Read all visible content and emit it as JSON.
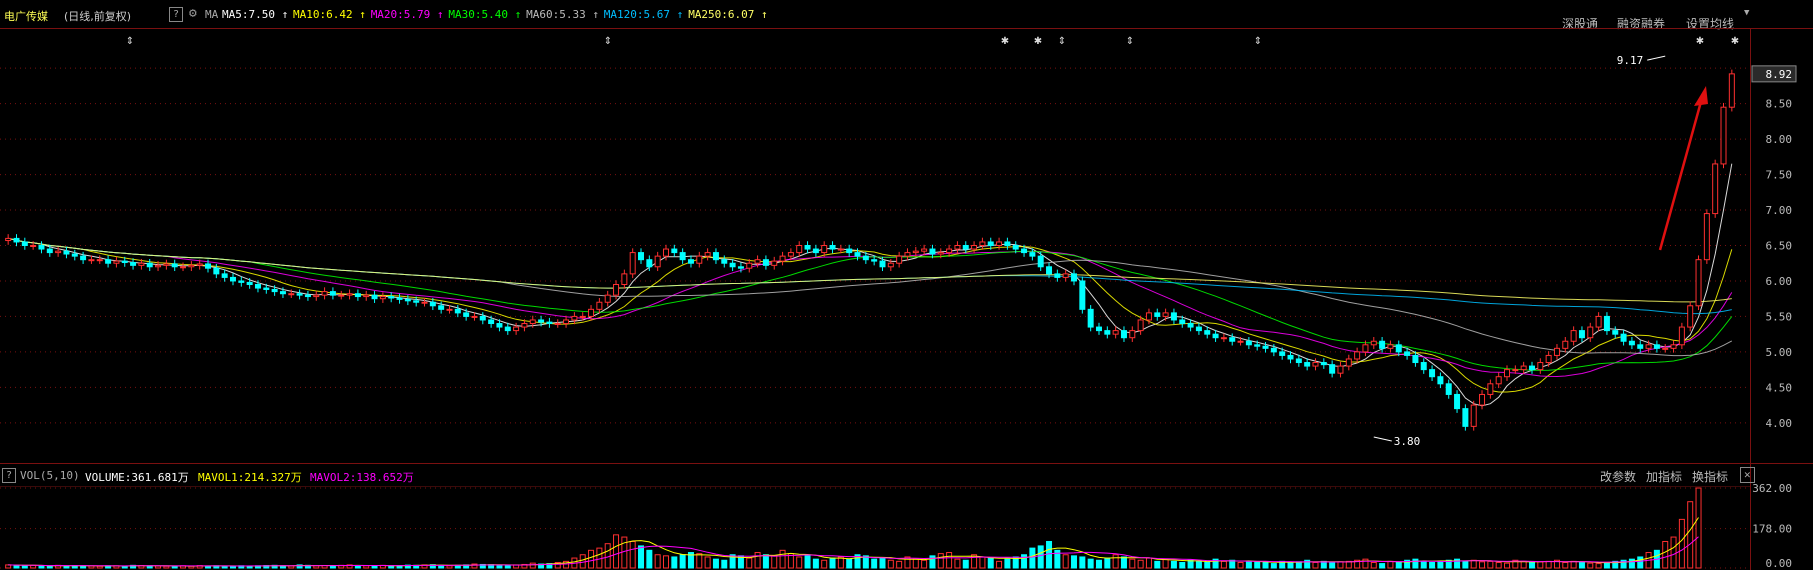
{
  "header": {
    "title": "电广传媒",
    "subtitle": "(日线,前复权)",
    "help": "?",
    "ma_prefix": "MA",
    "ma": [
      {
        "label": "MA5:7.50",
        "color": "#ffffff"
      },
      {
        "label": "MA10:6.42",
        "color": "#ffff00"
      },
      {
        "label": "MA20:5.79",
        "color": "#ff00ff"
      },
      {
        "label": "MA30:5.40",
        "color": "#00ff00"
      },
      {
        "label": "MA60:5.33",
        "color": "#bbbbbb"
      },
      {
        "label": "MA120:5.67",
        "color": "#00bfff"
      },
      {
        "label": "MA250:6.07",
        "color": "#ffff66"
      }
    ],
    "links": [
      "深股通",
      "融资融券",
      "设置均线"
    ]
  },
  "volume_header": {
    "help": "?",
    "label": "VOL(5,10)",
    "volume": "VOLUME:361.681万",
    "mavol1": "MAVOL1:214.327万",
    "mavol2": "MAVOL2:138.652万",
    "buttons": [
      "改参数",
      "加指标",
      "换指标"
    ],
    "close": "✕"
  },
  "colors": {
    "up": "#ff3030",
    "down": "#00ffff",
    "bg": "#000000",
    "grid": "#7a1010"
  },
  "chart_data": [
    {
      "type": "candlestick",
      "title": "电广传媒",
      "ylim": [
        3.8,
        9.2
      ],
      "y_ticks": [
        "9.00",
        "8.50",
        "8.00",
        "7.50",
        "7.00",
        "6.50",
        "6.00",
        "5.50",
        "5.00",
        "4.50",
        "4.00"
      ],
      "last_price": "8.92",
      "annotations": [
        {
          "text": "9.17",
          "x": 199,
          "y": 9.17
        },
        {
          "text": "3.80",
          "x": 164,
          "y": 3.8
        }
      ],
      "close": [
        6.6,
        6.55,
        6.5,
        6.5,
        6.45,
        6.4,
        6.42,
        6.38,
        6.35,
        6.3,
        6.3,
        6.3,
        6.25,
        6.28,
        6.26,
        6.22,
        6.25,
        6.2,
        6.22,
        6.24,
        6.2,
        6.2,
        6.22,
        6.24,
        6.18,
        6.1,
        6.05,
        6.0,
        5.98,
        5.95,
        5.9,
        5.88,
        5.85,
        5.82,
        5.82,
        5.8,
        5.78,
        5.8,
        5.85,
        5.8,
        5.8,
        5.82,
        5.78,
        5.8,
        5.75,
        5.78,
        5.76,
        5.74,
        5.72,
        5.7,
        5.7,
        5.65,
        5.6,
        5.6,
        5.55,
        5.5,
        5.5,
        5.45,
        5.4,
        5.35,
        5.3,
        5.35,
        5.4,
        5.45,
        5.42,
        5.4,
        5.4,
        5.45,
        5.5,
        5.5,
        5.6,
        5.7,
        5.8,
        5.95,
        6.1,
        6.4,
        6.3,
        6.2,
        6.35,
        6.45,
        6.4,
        6.3,
        6.25,
        6.35,
        6.4,
        6.3,
        6.25,
        6.2,
        6.18,
        6.25,
        6.3,
        6.22,
        6.28,
        6.35,
        6.4,
        6.5,
        6.45,
        6.4,
        6.5,
        6.45,
        6.45,
        6.4,
        6.35,
        6.3,
        6.28,
        6.2,
        6.25,
        6.35,
        6.4,
        6.42,
        6.45,
        6.38,
        6.4,
        6.45,
        6.5,
        6.45,
        6.5,
        6.55,
        6.5,
        6.55,
        6.5,
        6.45,
        6.4,
        6.35,
        6.2,
        6.1,
        6.05,
        6.1,
        6.0,
        5.6,
        5.35,
        5.3,
        5.25,
        5.3,
        5.2,
        5.3,
        5.45,
        5.55,
        5.5,
        5.55,
        5.45,
        5.4,
        5.35,
        5.3,
        5.25,
        5.2,
        5.2,
        5.15,
        5.15,
        5.1,
        5.08,
        5.05,
        5.0,
        4.95,
        4.9,
        4.85,
        4.8,
        4.85,
        4.82,
        4.7,
        4.8,
        4.9,
        5.0,
        5.1,
        5.15,
        5.05,
        5.1,
        5.0,
        4.95,
        4.85,
        4.75,
        4.65,
        4.55,
        4.4,
        4.2,
        3.95,
        4.25,
        4.4,
        4.55,
        4.65,
        4.75,
        4.75,
        4.8,
        4.75,
        4.85,
        4.95,
        5.05,
        5.15,
        5.3,
        5.2,
        5.35,
        5.5,
        5.3,
        5.25,
        5.15,
        5.1,
        5.05,
        5.1,
        5.05,
        5.05,
        5.1,
        5.35,
        5.65,
        6.3,
        6.95,
        7.65,
        8.45,
        8.92
      ]
    },
    {
      "type": "bar",
      "title": "VOL(5,10)",
      "ylim": [
        0,
        362
      ],
      "y_ticks": [
        "362.00",
        "178.00",
        "0.00"
      ],
      "values": [
        14,
        12,
        10,
        12,
        10,
        8,
        12,
        9,
        11,
        10,
        9,
        8,
        10,
        10,
        9,
        12,
        11,
        10,
        9,
        8,
        9,
        10,
        8,
        11,
        9,
        10,
        9,
        8,
        10,
        9,
        10,
        11,
        12,
        10,
        9,
        14,
        12,
        10,
        11,
        10,
        12,
        14,
        11,
        10,
        9,
        12,
        10,
        11,
        13,
        12,
        14,
        15,
        12,
        10,
        12,
        14,
        18,
        16,
        15,
        12,
        10,
        14,
        16,
        22,
        18,
        20,
        25,
        30,
        45,
        60,
        80,
        90,
        110,
        150,
        140,
        120,
        100,
        80,
        60,
        55,
        50,
        60,
        70,
        65,
        50,
        40,
        35,
        60,
        55,
        45,
        70,
        60,
        55,
        80,
        65,
        50,
        55,
        40,
        35,
        45,
        50,
        40,
        60,
        55,
        40,
        45,
        35,
        30,
        50,
        40,
        35,
        55,
        65,
        70,
        40,
        35,
        60,
        50,
        45,
        30,
        40,
        50,
        60,
        90,
        100,
        120,
        80,
        60,
        55,
        50,
        40,
        35,
        45,
        60,
        50,
        40,
        35,
        45,
        30,
        40,
        30,
        25,
        35,
        30,
        25,
        40,
        30,
        35,
        25,
        30,
        28,
        25,
        20,
        30,
        25,
        28,
        35,
        25,
        30,
        25,
        28,
        30,
        35,
        40,
        25,
        20,
        30,
        25,
        35,
        40,
        30,
        25,
        30,
        35,
        40,
        30,
        35,
        28,
        30,
        25,
        22,
        35,
        30,
        25,
        28,
        30,
        35,
        25,
        30,
        25,
        22,
        20,
        25,
        30,
        35,
        40,
        50,
        70,
        80,
        120,
        140,
        220,
        300,
        362
      ]
    }
  ]
}
